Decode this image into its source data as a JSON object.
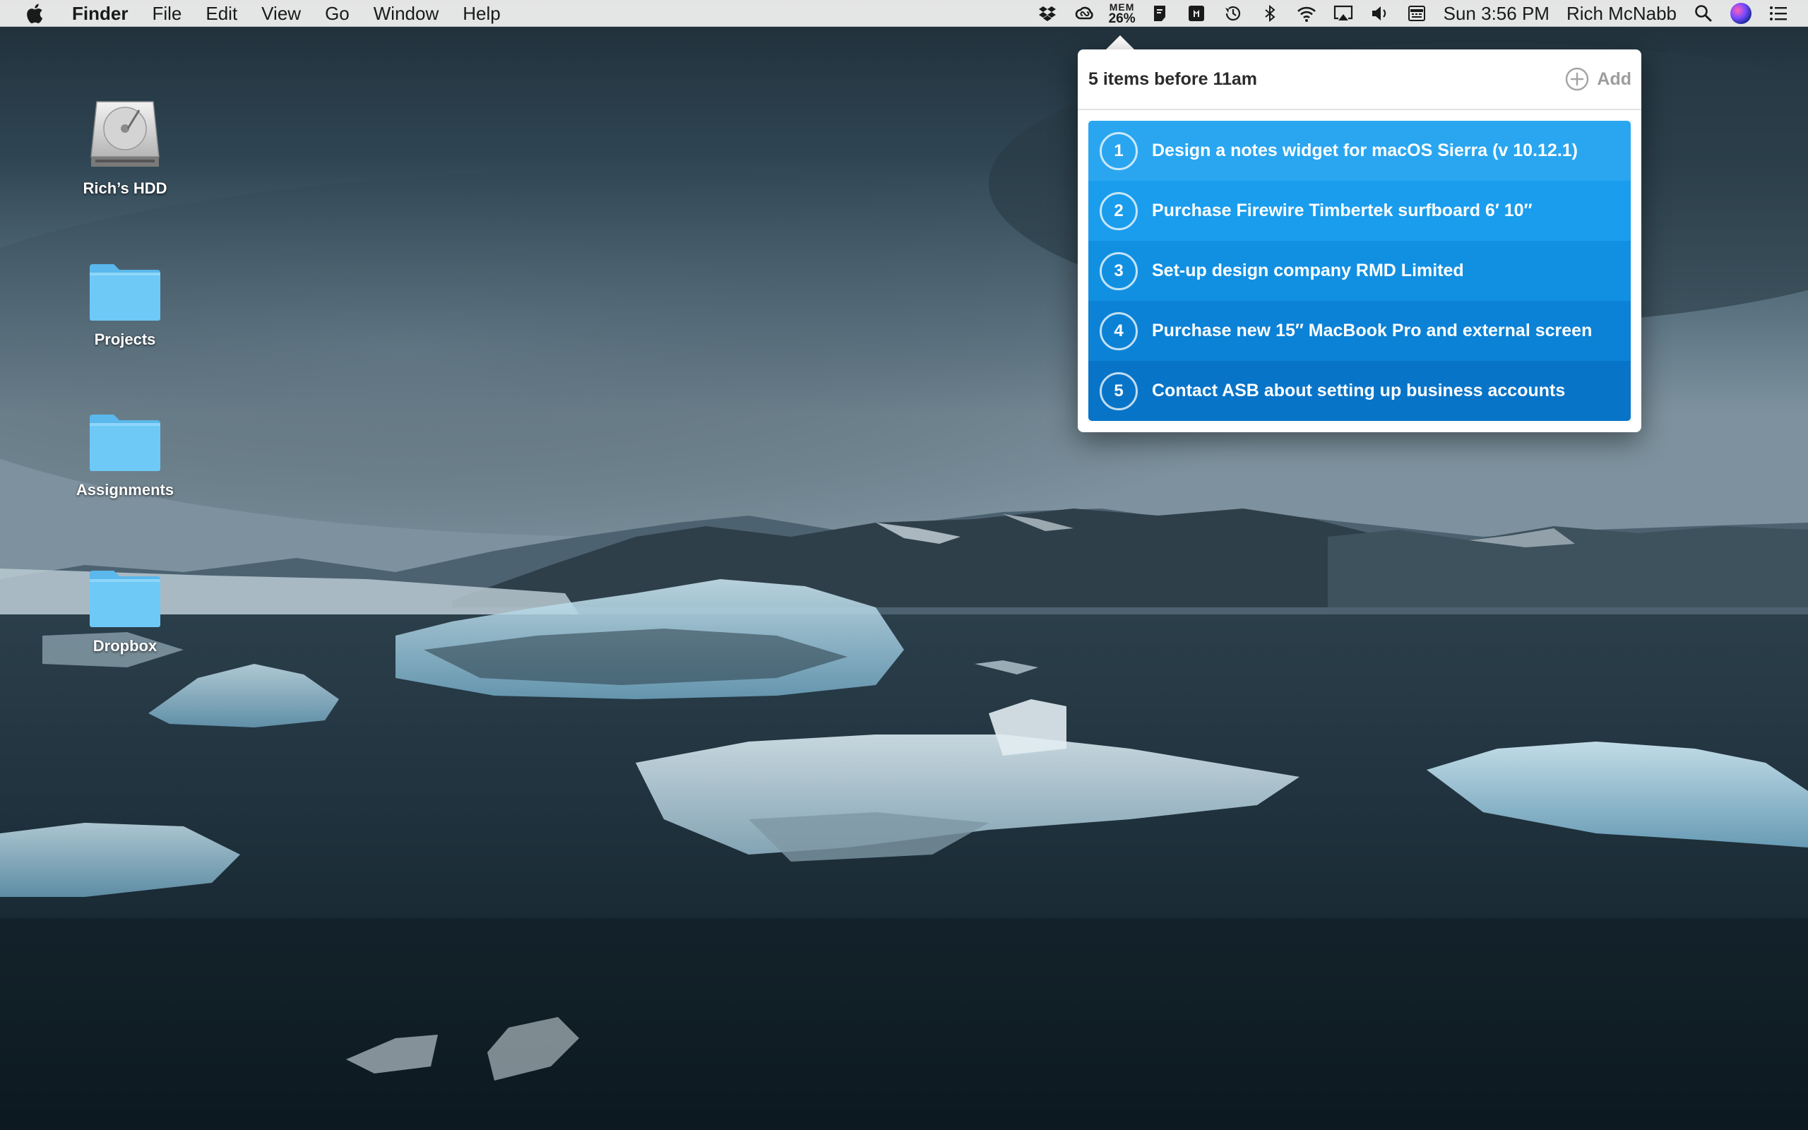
{
  "menubar": {
    "app_name": "Finder",
    "menus": [
      "File",
      "Edit",
      "View",
      "Go",
      "Window",
      "Help"
    ],
    "status_icons": [
      "dropbox-icon",
      "creative-cloud-icon",
      "tasks-app-icon",
      "screen-icon",
      "time-machine-icon",
      "bluetooth-icon",
      "wifi-icon",
      "airplay-icon",
      "volume-icon",
      "keyboard-input-icon",
      "spotlight-search-icon",
      "siri-icon",
      "notification-center-icon"
    ],
    "memory": {
      "label": "MEM",
      "value": "26%"
    },
    "clock": "Sun 3:56 PM",
    "user": "Rich McNabb"
  },
  "desktop": {
    "icons": [
      {
        "label": "Rich’s HDD",
        "type": "hard-drive"
      },
      {
        "label": "Projects",
        "type": "folder"
      },
      {
        "label": "Assignments",
        "type": "folder"
      },
      {
        "label": "Dropbox",
        "type": "folder"
      }
    ]
  },
  "popover": {
    "title": "5 items before 11am",
    "add_label": "Add",
    "items": [
      {
        "number": "1",
        "text": "Design a notes widget for macOS Sierra (v 10.12.1)",
        "color": "#2aa6f0"
      },
      {
        "number": "2",
        "text": "Purchase Firewire Timbertek surfboard 6′ 10″",
        "color": "#1a9ded"
      },
      {
        "number": "3",
        "text": "Set-up design company RMD Limited",
        "color": "#1190e2"
      },
      {
        "number": "4",
        "text": "Purchase new 15″ MacBook Pro and external screen",
        "color": "#0b82d6"
      },
      {
        "number": "5",
        "text": "Contact ASB about setting up business accounts",
        "color": "#0874c8"
      }
    ]
  },
  "colors": {
    "folder": "#6ec9f7",
    "menubar_bg": "#ececec",
    "task_accent": "#1a9ded"
  }
}
